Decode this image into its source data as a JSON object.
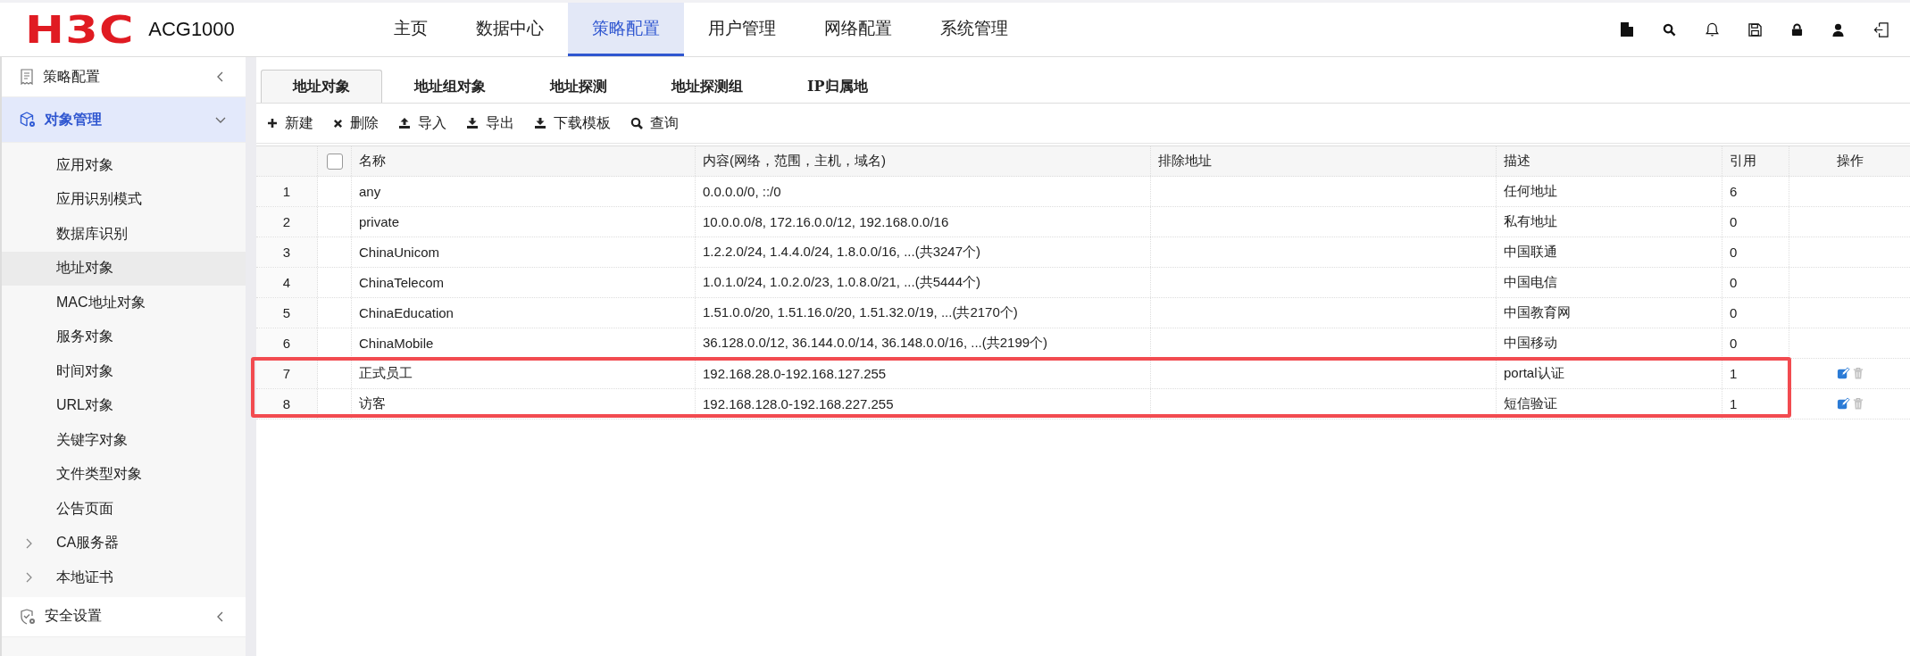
{
  "header": {
    "brand": "H3C",
    "product": "ACG1000",
    "nav": [
      {
        "label": "主页",
        "selected": false
      },
      {
        "label": "数据中心",
        "selected": false
      },
      {
        "label": "策略配置",
        "selected": true
      },
      {
        "label": "用户管理",
        "selected": false
      },
      {
        "label": "网络配置",
        "selected": false
      },
      {
        "label": "系统管理",
        "selected": false
      }
    ]
  },
  "sidebar": {
    "groups": [
      {
        "label": "策略配置",
        "expanded": false,
        "selected": false
      },
      {
        "label": "对象管理",
        "expanded": true,
        "selected": true,
        "children": [
          {
            "label": "应用对象",
            "selected": false,
            "kind": "leaf"
          },
          {
            "label": "应用识别模式",
            "selected": false,
            "kind": "leaf"
          },
          {
            "label": "数据库识别",
            "selected": false,
            "kind": "leaf"
          },
          {
            "label": "地址对象",
            "selected": true,
            "kind": "leaf"
          },
          {
            "label": "MAC地址对象",
            "selected": false,
            "kind": "leaf"
          },
          {
            "label": "服务对象",
            "selected": false,
            "kind": "leaf"
          },
          {
            "label": "时间对象",
            "selected": false,
            "kind": "leaf"
          },
          {
            "label": "URL对象",
            "selected": false,
            "kind": "leaf"
          },
          {
            "label": "关键字对象",
            "selected": false,
            "kind": "leaf"
          },
          {
            "label": "文件类型对象",
            "selected": false,
            "kind": "leaf"
          },
          {
            "label": "公告页面",
            "selected": false,
            "kind": "leaf"
          },
          {
            "label": "CA服务器",
            "selected": false,
            "kind": "folder"
          },
          {
            "label": "本地证书",
            "selected": false,
            "kind": "folder"
          }
        ]
      },
      {
        "label": "安全设置",
        "expanded": false,
        "selected": false
      }
    ]
  },
  "tabs": [
    {
      "label": "地址对象",
      "selected": true
    },
    {
      "label": "地址组对象",
      "selected": false
    },
    {
      "label": "地址探测",
      "selected": false
    },
    {
      "label": "地址探测组",
      "selected": false
    },
    {
      "label": "IP归属地",
      "selected": false
    }
  ],
  "toolbar": [
    "新建",
    "删除",
    "导入",
    "导出",
    "下载模板",
    "查询"
  ],
  "table": {
    "select_all_checked": false,
    "columns": [
      "名称",
      "内容(网络，范围，主机，域名)",
      "排除地址",
      "描述",
      "引用",
      "操作"
    ],
    "rows": [
      {
        "index": "1",
        "name": "any",
        "content": "0.0.0.0/0, ::/0",
        "description": "任何地址",
        "references": "6",
        "actions": false,
        "highlighted": false
      },
      {
        "index": "2",
        "name": "private",
        "content": "10.0.0.0/8, 172.16.0.0/12, 192.168.0.0/16",
        "description": "私有地址",
        "references": "0",
        "actions": false,
        "highlighted": false
      },
      {
        "index": "3",
        "name": "ChinaUnicom",
        "content": "1.2.2.0/24, 1.4.4.0/24, 1.8.0.0/16, ...(共3247个)",
        "description": "中国联通",
        "references": "0",
        "actions": false,
        "highlighted": false
      },
      {
        "index": "4",
        "name": "ChinaTelecom",
        "content": "1.0.1.0/24, 1.0.2.0/23, 1.0.8.0/21, ...(共5444个)",
        "description": "中国电信",
        "references": "0",
        "actions": false,
        "highlighted": false
      },
      {
        "index": "5",
        "name": "ChinaEducation",
        "content": "1.51.0.0/20, 1.51.16.0/20, 1.51.32.0/19, ...(共2170个)",
        "description": "中国教育网",
        "references": "0",
        "actions": false,
        "highlighted": false
      },
      {
        "index": "6",
        "name": "ChinaMobile",
        "content": "36.128.0.0/12, 36.144.0.0/14, 36.148.0.0/16, ...(共2199个)",
        "description": "中国移动",
        "references": "0",
        "actions": false,
        "highlighted": false
      },
      {
        "index": "7",
        "name": "正式员工",
        "content": "192.168.28.0-192.168.127.255",
        "description": "portal认证",
        "references": "1",
        "actions": true,
        "highlighted": true
      },
      {
        "index": "8",
        "name": "访客",
        "content": "192.168.128.0-192.168.227.255",
        "description": "短信验证",
        "references": "1",
        "actions": true,
        "highlighted": true
      }
    ]
  }
}
